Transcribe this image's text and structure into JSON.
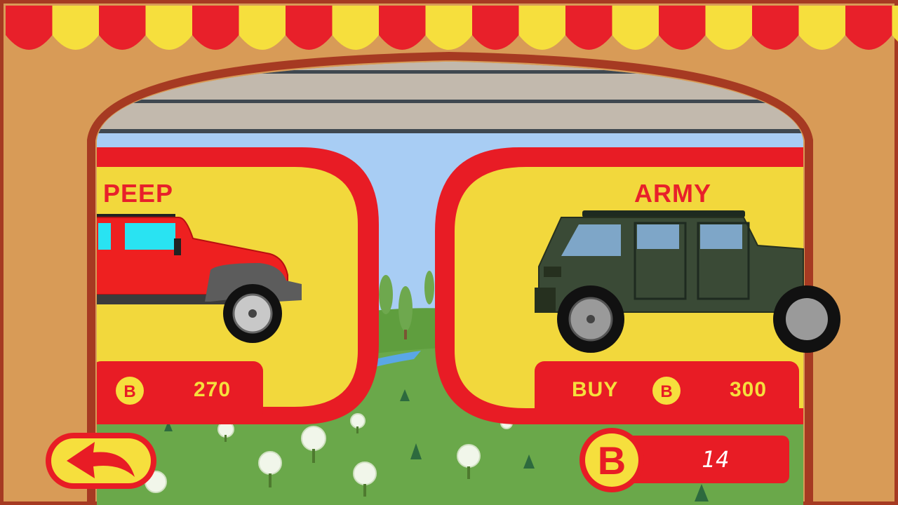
{
  "shop": {
    "cars": [
      {
        "name": "PEEP",
        "price": "270",
        "action": ""
      },
      {
        "name": "ARMY",
        "price": "300",
        "action": "BUY"
      }
    ]
  },
  "wallet": {
    "balance": "14",
    "icon": "bitcoin-icon"
  },
  "back_button": {
    "icon": "back-arrow-icon"
  },
  "colors": {
    "awning_red": "#e8202a",
    "awning_yellow": "#f6df3d",
    "wall": "#d89b57",
    "card_yellow": "#f2d83c",
    "card_red": "#e81c25",
    "sky": "#a8cdf4",
    "grass": "#6aa84a"
  }
}
